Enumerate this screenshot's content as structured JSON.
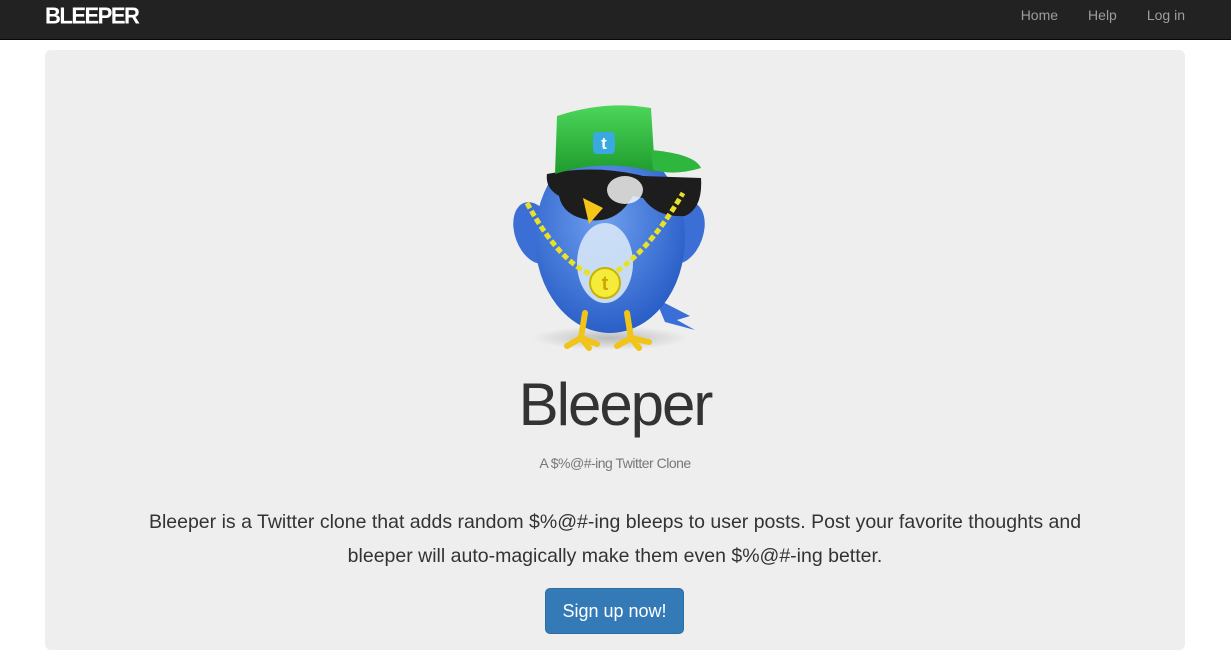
{
  "navbar": {
    "brand": "BLEEPER",
    "links": [
      {
        "label": "Home"
      },
      {
        "label": "Help"
      },
      {
        "label": "Log in"
      }
    ]
  },
  "hero": {
    "mascot_icon": "twitter-bird-with-cap-sunglasses-chain-icon",
    "title": "Bleeper",
    "subtitle": "A $%@#-ing Twitter Clone",
    "lead_line1": "Bleeper is a Twitter clone that adds random $%@#-ing bleeps to user posts. Post your favorite thoughts and",
    "lead_line2": "bleeper will auto-magically make them even $%@#-ing better.",
    "signup_label": "Sign up now!"
  },
  "colors": {
    "navbar_bg": "#222222",
    "jumbotron_bg": "#eeeeee",
    "primary": "#337ab7"
  }
}
